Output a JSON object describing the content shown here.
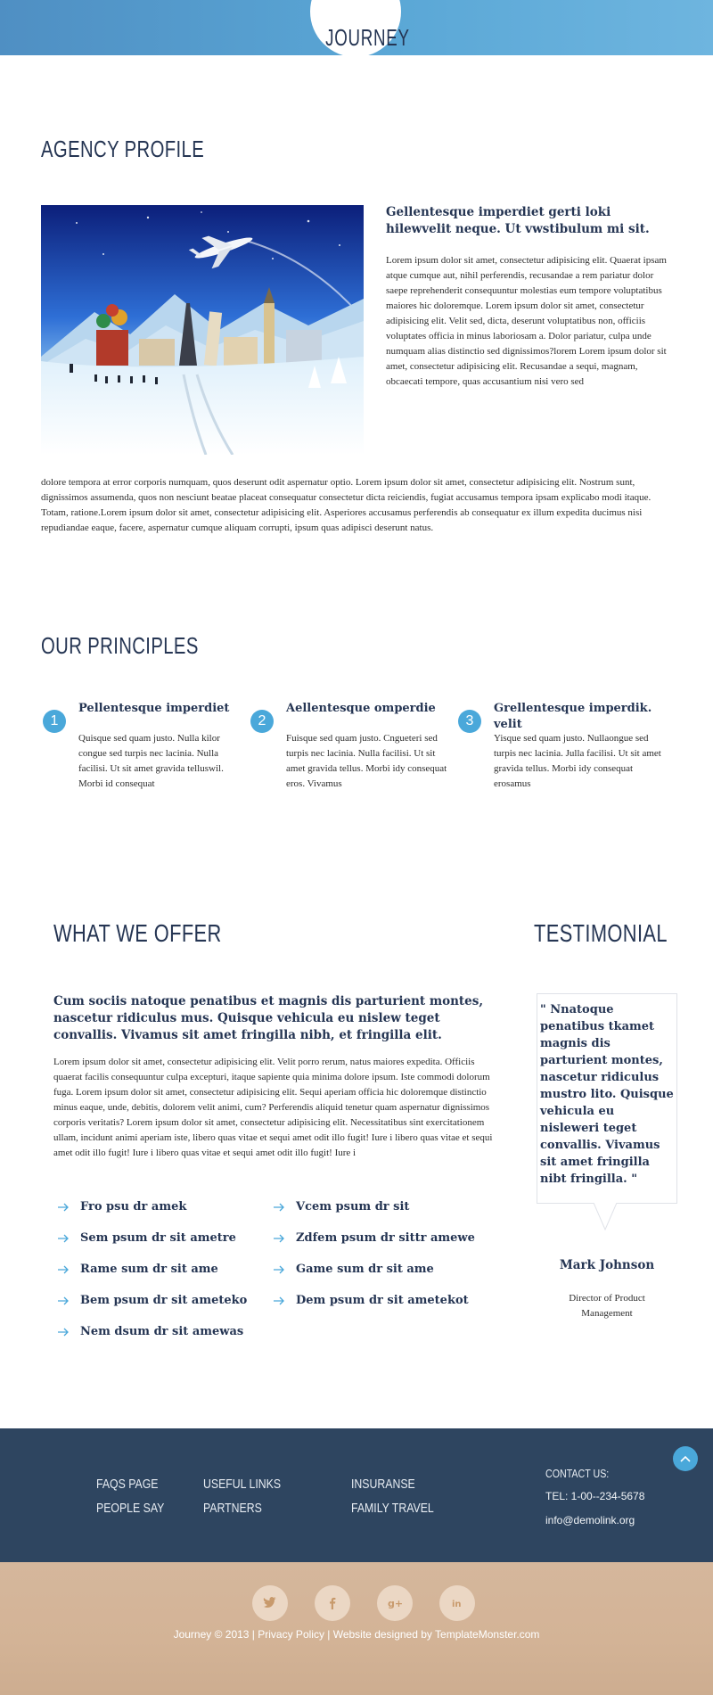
{
  "header": {
    "logo": "JOURNEY"
  },
  "agency": {
    "title": "AGENCY PROFILE",
    "intro_heading": "Gellentesque imperdiet gerti loki hilewvelit neque. Ut vwstibulum mi sit.",
    "paragraph_side": "Lorem ipsum dolor sit amet, consectetur adipisicing elit. Quaerat ipsam atque cumque aut, nihil perferendis, recusandae a rem pariatur dolor saepe reprehenderit consequuntur molestias eum tempore voluptatibus maiores hic doloremque. Lorem ipsum dolor sit amet, consectetur adipisicing elit. Velit sed, dicta, deserunt voluptatibus non, officiis voluptates officia in minus laboriosam a. Dolor pariatur, culpa unde numquam alias distinctio sed dignissimos?lorem Lorem ipsum dolor sit amet, consectetur adipisicing elit. Recusandae a sequi, magnam, obcaecati tempore, quas accusantium nisi vero sed",
    "paragraph_full": "dolore tempora at error corporis numquam, quos deserunt odit aspernatur optio. Lorem ipsum dolor sit amet, consectetur adipisicing elit. Nostrum sunt, dignissimos assumenda, quos non nesciunt beatae placeat consequatur consectetur dicta reiciendis, fugiat accusamus tempora ipsam explicabo modi itaque. Totam, ratione.Lorem ipsum dolor sit amet, consectetur adipisicing elit. Asperiores accusamus perferendis ab consequatur ex illum expedita ducimus nisi repudiandae eaque, facere, aspernatur cumque aliquam corrupti, ipsum quas adipisci deserunt natus."
  },
  "principles": {
    "title": "OUR PRINCIPLES",
    "items": [
      {
        "num": "1",
        "title": "Pellentesque imperdiet",
        "text": "Quisque sed quam justo. Nulla kilor congue sed turpis nec lacinia. Nulla facilisi. Ut sit amet gravida telluswil. Morbi id consequat"
      },
      {
        "num": "2",
        "title": "Aellentesque omperdie",
        "text": "Fuisque sed quam justo. Cngueteri sed turpis nec lacinia. Nulla facilisi. Ut sit amet gravida tellus. Morbi idy consequat eros. Vivamus"
      },
      {
        "num": "3",
        "title": "Grellentesque imperdik. velit",
        "text": "Yisque sed quam justo. Nullaongue sed turpis nec lacinia. Julla facilisi. Ut sit amet gravida tellus. Morbi idy consequat erosamus"
      }
    ]
  },
  "offer": {
    "title": "WHAT WE OFFER",
    "heading": "Cum sociis natoque penatibus et magnis dis parturient montes, nascetur ridiculus mus. Quisque vehicula eu nislew teget convallis. Vivamus sit amet fringilla nibh, et fringilla elit.",
    "paragraph": "Lorem ipsum dolor sit amet, consectetur adipisicing elit. Velit porro rerum, natus maiores expedita. Officiis quaerat facilis consequuntur culpa excepturi, itaque sapiente quia minima dolore ipsum. Iste commodi dolorum fuga. Lorem ipsum dolor sit amet, consectetur adipisicing elit. Sequi aperiam officia hic doloremque distinctio minus eaque, unde, debitis, dolorem velit animi, cum? Perferendis aliquid tenetur quam aspernatur dignissimos corporis veritatis? Lorem ipsum dolor sit amet, consectetur adipisicing elit. Necessitatibus sint exercitationem ullam, incidunt animi aperiam iste, libero quas vitae et sequi amet odit illo fugit! Iure i libero quas vitae et sequi amet odit illo fugit! Iure i libero quas vitae et sequi amet odit illo fugit! Iure i",
    "list_left": [
      "Fro psu dr amek",
      "Sem psum dr sit ametre",
      "Rame sum dr sit ame",
      "Bem psum dr sit ameteko",
      "Nem dsum dr sit amewas"
    ],
    "list_right": [
      "Vcem psum dr sit",
      "Zdfem psum dr sittr amewe",
      "Game sum dr sit ame",
      "Dem psum dr sit ametekot"
    ]
  },
  "testimonial": {
    "title": "TESTIMONIAL",
    "quote": "\" Nnatoque penatibus tkamet magnis dis parturient montes, nascetur ridiculus mustro lito. Quisque vehicula eu nisleweri teget convallis. Vivamus sit amet fringilla nibt fringilla. \"",
    "name": "Mark Johnson",
    "role": "Director of Product Management"
  },
  "footer": {
    "col1": [
      "FAQS PAGE",
      "PEOPLE SAY"
    ],
    "col2": [
      "USEFUL LINKS",
      "PARTNERS"
    ],
    "col3": [
      "INSURANSE",
      "FAMILY TRAVEL"
    ],
    "contact_label": "CONTACT US:",
    "phone": "TEL: 1-00--234-5678",
    "email": "info@demolink.org",
    "copyright": "Journey © 2013 | Privacy Policy | Website designed by TemplateMonster.com",
    "social_icons": [
      "twitter-icon",
      "facebook-icon",
      "google-plus-icon",
      "linkedin-icon"
    ],
    "colors": {
      "footer_top": "#2e4560",
      "footer_bottom": "#d5b79c",
      "accent": "#4aa8da"
    }
  }
}
